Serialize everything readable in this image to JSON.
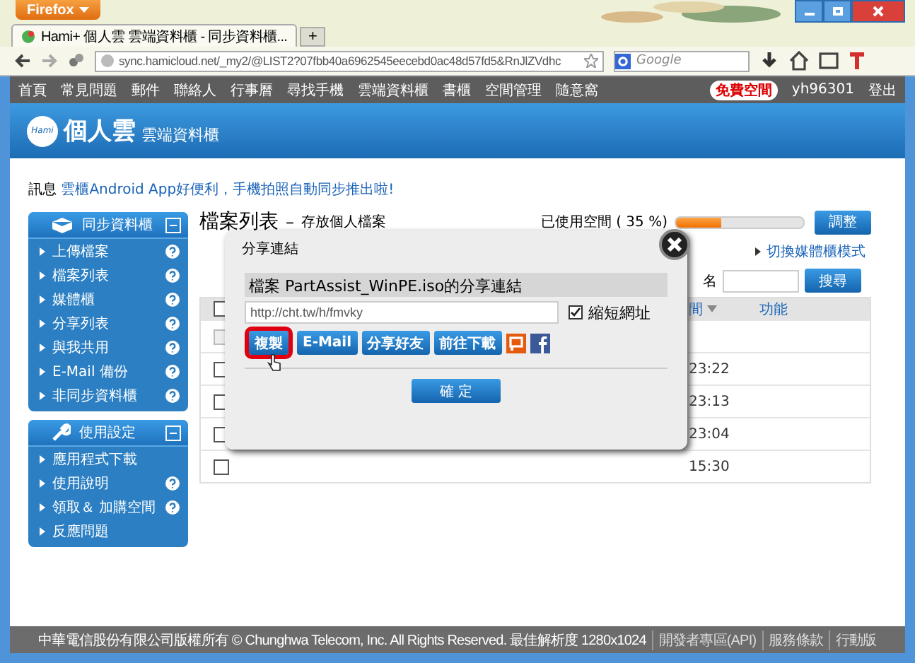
{
  "browser": {
    "app_button": "Firefox",
    "tabs": [
      {
        "title": "Hami+ 個人雲 雲端資料櫃 - 同步資料櫃...",
        "selected": true
      }
    ],
    "new_tab": "+",
    "url": "sync.hamicloud.net/_my2/@LIST2?07fbb40a6962545eecebd0ac48d57fd5&RnJlZVdhc",
    "search_placeholder": "Google"
  },
  "site_nav": {
    "items": [
      "首頁",
      "常見問題",
      "郵件",
      "聯絡人",
      "行事曆",
      "尋找手機",
      "雲端資料櫃",
      "書櫃",
      "空間管理",
      "隨意窩"
    ],
    "badge": "免費空間",
    "user": "yh96301",
    "logout": "登出"
  },
  "header": {
    "logo_text": "Hami",
    "title": "個人雲",
    "subtitle": "雲端資料櫃"
  },
  "notice": {
    "label": "訊息",
    "link": "雲櫃Android App好便利，手機拍照自動同步推出啦!"
  },
  "sidebar": [
    {
      "title": "同步資料櫃",
      "kind": "sync",
      "items": [
        {
          "label": "上傳檔案",
          "help": true
        },
        {
          "label": "檔案列表",
          "help": true
        },
        {
          "label": "媒體櫃",
          "help": true
        },
        {
          "label": "分享列表",
          "help": true
        },
        {
          "label": "與我共用",
          "help": true
        },
        {
          "label": "E-Mail 備份",
          "help": true
        },
        {
          "label": "非同步資料櫃",
          "help": true
        }
      ]
    },
    {
      "title": "使用設定",
      "kind": "settings",
      "items": [
        {
          "label": "應用程式下載",
          "help": false
        },
        {
          "label": "使用說明",
          "help": true
        },
        {
          "label": "領取＆ 加購空間",
          "help": true
        },
        {
          "label": "反應問題",
          "help": false
        }
      ]
    }
  ],
  "main": {
    "title": "檔案列表",
    "separator": "–",
    "subtitle": "存放個人檔案",
    "usage_label": "已使用空間 ( 35 %)",
    "usage": {
      "level": 0.35
    },
    "adjust_button": "調整",
    "switch_link": "切換媒體櫃模式",
    "search_label": "名",
    "search_button": "搜尋",
    "table": {
      "select_all": {
        "checked": false
      },
      "columns": [
        "間",
        "功能"
      ],
      "rows": [
        {
          "disabled": true
        },
        {
          "disabled": false,
          "time": "23:22"
        },
        {
          "disabled": false,
          "time": "23:13"
        },
        {
          "disabled": false,
          "time": "23:04"
        },
        {
          "disabled": false,
          "time": "15:30"
        }
      ]
    }
  },
  "dialog": {
    "title": "分享連結",
    "heading": "檔案 PartAssist_WinPE.iso的分享連結",
    "url": "http://cht.tw/h/fmvky",
    "shorten": {
      "label": "縮短網址",
      "checked": true
    },
    "buttons": [
      {
        "label": "複製",
        "selected": true
      },
      {
        "label": "E-Mail",
        "selected": false
      },
      {
        "label": "分享好友",
        "selected": false
      },
      {
        "label": "前往下載",
        "selected": false
      }
    ],
    "ok": "確 定"
  },
  "footer": {
    "copyright": "中華電信股份有限公司版權所有 © Chunghwa Telecom, Inc. All Rights Reserved. 最佳解析度 1280x1024",
    "links": [
      "開發者專區(API)",
      "服務條款",
      "行動版"
    ]
  }
}
